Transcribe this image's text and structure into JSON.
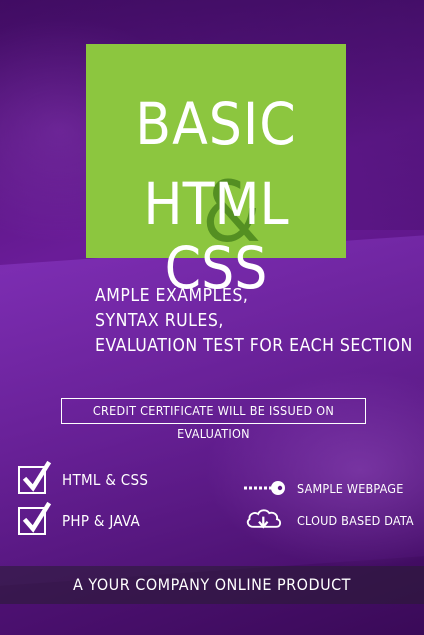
{
  "title": {
    "line1": "BASIC",
    "line2": "HTML CSS",
    "ampersand": "&"
  },
  "features": [
    "AMPLE EXAMPLES,",
    "SYNTAX RULES,",
    "EVALUATION TEST FOR EACH SECTION"
  ],
  "certificate": "CREDIT CERTIFICATE WILL BE ISSUED ON EVALUATION",
  "checklist": [
    {
      "label": "HTML & CSS",
      "icon": "checkbox-checked-icon"
    },
    {
      "label": "PHP & JAVA",
      "icon": "checkbox-checked-icon"
    }
  ],
  "services": [
    {
      "label": "SAMPLE WEBPAGE",
      "icon": "key-icon"
    },
    {
      "label": "CLOUD BASED DATA",
      "icon": "cloud-download-icon"
    }
  ],
  "footer": "A YOUR COMPANY ONLINE PRODUCT",
  "colors": {
    "accent_green": "#8cc63f",
    "ampersand_green": "#4f8a1f",
    "background_purple": "#5a1584"
  }
}
